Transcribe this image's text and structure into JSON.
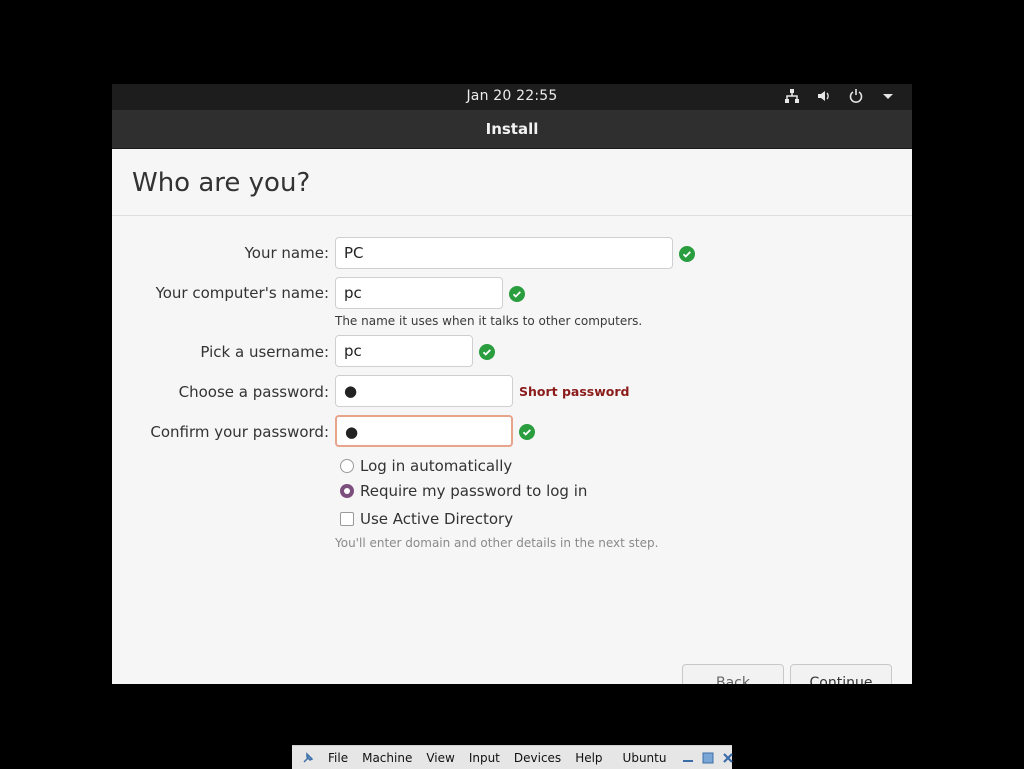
{
  "topbar": {
    "clock": "Jan 20  22:55",
    "tray_icons": [
      "network-icon",
      "volume-icon",
      "power-icon",
      "dropdown-icon"
    ]
  },
  "window": {
    "title": "Install"
  },
  "page": {
    "heading": "Who are you?"
  },
  "form": {
    "your_name": {
      "label": "Your name:",
      "value": "PC"
    },
    "computer_name": {
      "label": "Your computer's name:",
      "value": "pc",
      "help": "The name it uses when it talks to other computers."
    },
    "username": {
      "label": "Pick a username:",
      "value": "pc"
    },
    "password": {
      "label": "Choose a password:",
      "value": "●",
      "warning": "Short password"
    },
    "confirm_password": {
      "label": "Confirm your password:",
      "value": "●"
    },
    "login_options": [
      {
        "label": "Log in automatically",
        "selected": false
      },
      {
        "label": "Require my password to log in",
        "selected": true
      }
    ],
    "active_directory": {
      "label": "Use Active Directory",
      "checked": false,
      "help": "You'll enter domain and other details in the next step."
    }
  },
  "buttons": {
    "back": "Back",
    "continue": "Continue"
  },
  "hostbar": {
    "menus": [
      "File",
      "Machine",
      "View",
      "Input",
      "Devices",
      "Help"
    ],
    "vm_name": "Ubuntu"
  },
  "colors": {
    "accent": "#7d4f7e",
    "ok_green": "#2a9d3f",
    "warning": "#8b1b1b",
    "focus_border": "#e8a48a"
  }
}
